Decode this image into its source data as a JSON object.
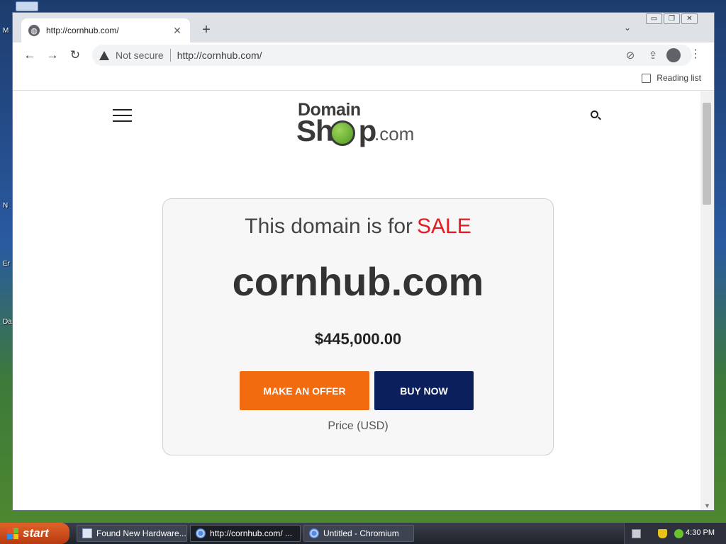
{
  "desktop": {
    "labels": [
      "M",
      "N",
      "Er",
      "Da"
    ]
  },
  "browser": {
    "tab": {
      "title": "http://cornhub.com/",
      "close_glyph": "✕"
    },
    "new_tab_glyph": "+",
    "tab_menu_glyph": "⌄",
    "window_controls": [
      "▭",
      "❐",
      "✕"
    ],
    "nav": {
      "back": "←",
      "forward": "→",
      "reload": "↻"
    },
    "omnibox": {
      "security_label": "Not secure",
      "url": "http://cornhub.com/"
    },
    "omni_icons": {
      "eye": "⊘",
      "share": "⇪",
      "star": "☆"
    },
    "menu_glyph": "⋮",
    "reading_list_label": "Reading list"
  },
  "page": {
    "logo": {
      "top": "Domain",
      "shop_s": "Sh",
      "shop_p": "p",
      "suffix": ".com"
    },
    "heading_text": "This domain is for",
    "heading_highlight": "SALE",
    "domain_name": "cornhub.com",
    "price": "$445,000.00",
    "offer_button": "MAKE AN OFFER",
    "buy_button": "BUY NOW",
    "currency_note": "Price (USD)"
  },
  "colors": {
    "sale_red": "#e31b23",
    "offer_orange": "#f26b0f",
    "buy_navy": "#0b1f5c"
  },
  "taskbar": {
    "start_label": "start",
    "tasks": [
      {
        "label": "Found New Hardware..."
      },
      {
        "label": "http://cornhub.com/ ..."
      },
      {
        "label": "Untitled - Chromium"
      }
    ],
    "clock": "4:30 PM"
  }
}
